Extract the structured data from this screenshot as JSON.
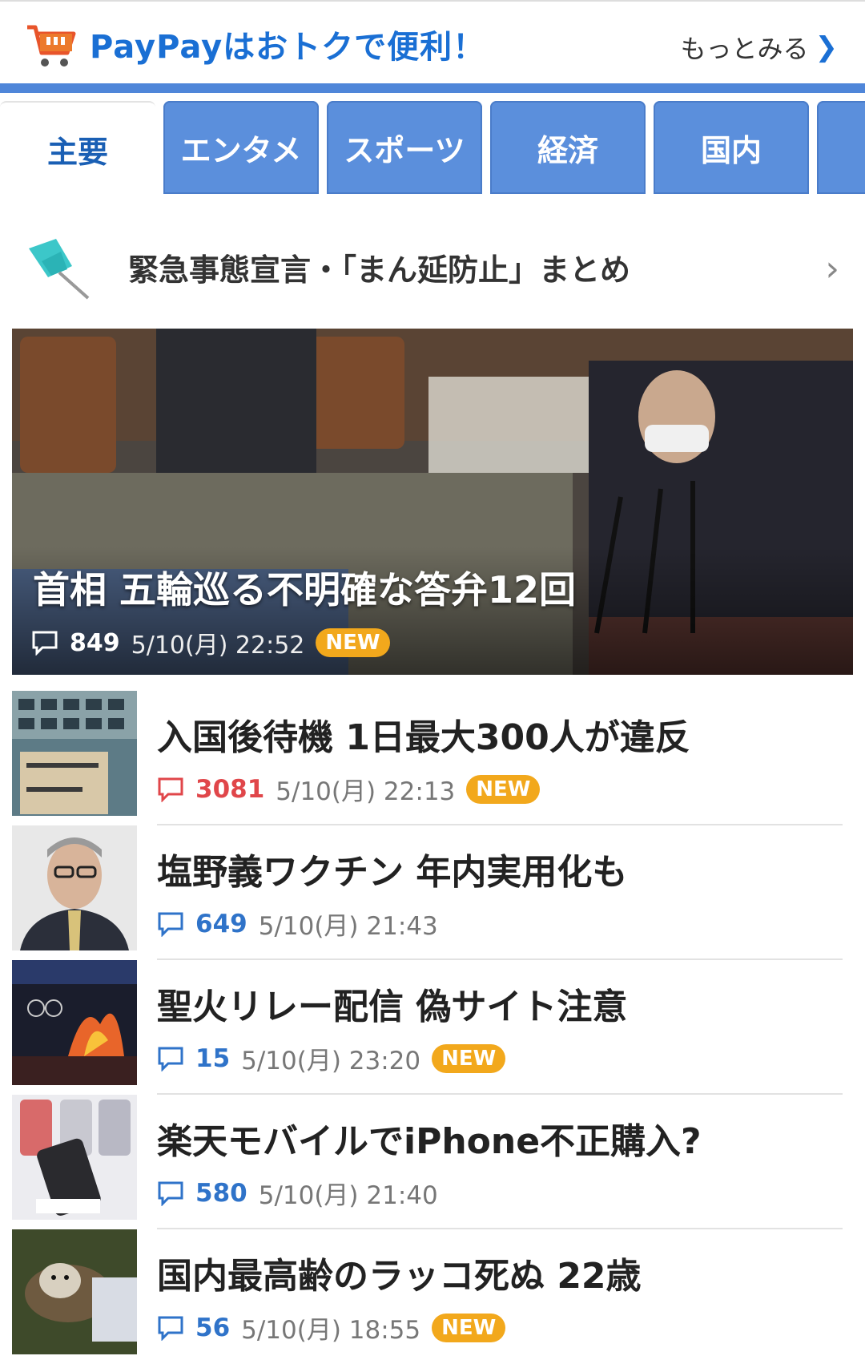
{
  "promo": {
    "title": "PayPayはおトクで便利！",
    "more_label": "もっとみる",
    "icon": "shopping-cart-icon",
    "accent": "#1a6fd4"
  },
  "tabs": [
    {
      "label": "主要",
      "active": true
    },
    {
      "label": "エンタメ",
      "active": false
    },
    {
      "label": "スポーツ",
      "active": false
    },
    {
      "label": "経済",
      "active": false
    },
    {
      "label": "国内",
      "active": false
    }
  ],
  "pinned": {
    "icon": "pushpin-icon",
    "label": "緊急事態宣言・「まん延防止」まとめ"
  },
  "hero": {
    "title": "首相 五輪巡る不明確な答弁12回",
    "comments": "849",
    "datetime": "5/10(月) 22:52",
    "badge": "NEW"
  },
  "articles": [
    {
      "title": "入国後待機 1日最大300人が違反",
      "comments": "3081",
      "datetime": "5/10(月) 22:13",
      "badge": "NEW",
      "hot": true
    },
    {
      "title": "塩野義ワクチン 年内実用化も",
      "comments": "649",
      "datetime": "5/10(月) 21:43",
      "badge": "",
      "hot": false
    },
    {
      "title": "聖火リレー配信 偽サイト注意",
      "comments": "15",
      "datetime": "5/10(月) 23:20",
      "badge": "NEW",
      "hot": false
    },
    {
      "title": "楽天モバイルでiPhone不正購入?",
      "comments": "580",
      "datetime": "5/10(月) 21:40",
      "badge": "",
      "hot": false
    },
    {
      "title": "国内最高齢のラッコ死ぬ 22歳",
      "comments": "56",
      "datetime": "5/10(月) 18:55",
      "badge": "NEW",
      "hot": false
    }
  ],
  "colors": {
    "tab_bg": "#5b8fdc",
    "new_badge": "#f2a81c",
    "comment_blue": "#2f73c9",
    "comment_hot": "#e0464a"
  }
}
